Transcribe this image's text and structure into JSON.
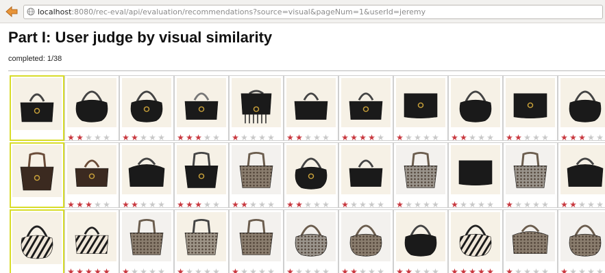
{
  "browser": {
    "url_host": "localhost",
    "url_rest": ":8080/rec-eval/api/evaluation/recommendations?source=visual&pageNum=1&userId=jeremy"
  },
  "page": {
    "title": "Part I: User judge by visual similarity",
    "completed": "completed: 1/38"
  },
  "colors": {
    "query_border": "#d8dc29",
    "star_on": "#c8383f",
    "star_off": "#c9c9c9"
  },
  "rows": [
    {
      "query": {
        "bag": "black-satchel-gold-logo"
      },
      "recommendations": [
        {
          "bag": "black-hobo",
          "rating": 2
        },
        {
          "bag": "black-leather-hobo-ring",
          "rating": 2
        },
        {
          "bag": "black-patent-shoulder-logo",
          "rating": 3
        },
        {
          "bag": "black-fringe-tote",
          "rating": 1
        },
        {
          "bag": "black-top-handle",
          "rating": 2
        },
        {
          "bag": "black-large-satchel-logo",
          "rating": 4
        },
        {
          "bag": "black-clutch-gold-ring",
          "rating": 1
        },
        {
          "bag": "black-small-hobo",
          "rating": 2
        },
        {
          "bag": "black-flap-chain-logo",
          "rating": 2
        },
        {
          "bag": "black-bamboo-hobo",
          "rating": 3
        }
      ]
    },
    {
      "query": {
        "bag": "dark-brown-tote-ring"
      },
      "recommendations": [
        {
          "bag": "brown-satchel-logo",
          "rating": 3
        },
        {
          "bag": "black-doctor-bag",
          "rating": 2
        },
        {
          "bag": "black-tote-ring",
          "rating": 3
        },
        {
          "bag": "monogram-tote-brown",
          "rating": 2
        },
        {
          "bag": "black-hobo-ring",
          "rating": 2
        },
        {
          "bag": "black-beaded-lady-bag",
          "rating": 1
        },
        {
          "bag": "monogram-tote-grey",
          "rating": 1
        },
        {
          "bag": "black-patent-clutch",
          "rating": 1
        },
        {
          "bag": "grey-monogram-tote",
          "rating": 1
        },
        {
          "bag": "black-boston-bag",
          "rating": 2
        }
      ]
    },
    {
      "query": {
        "bag": "zebra-hobo"
      },
      "recommendations": [
        {
          "bag": "zebra-shoulder-bag",
          "rating": 5
        },
        {
          "bag": "monogram-tote-brown-trim",
          "rating": 1
        },
        {
          "bag": "grey-canvas-tote",
          "rating": 1
        },
        {
          "bag": "monogram-shopper",
          "rating": 1
        },
        {
          "bag": "grey-monogram-hobo",
          "rating": 1
        },
        {
          "bag": "monogram-hobo-tassel",
          "rating": 2
        },
        {
          "bag": "black-leather-hobo",
          "rating": 2
        },
        {
          "bag": "zebra-bamboo-hobo",
          "rating": 5
        },
        {
          "bag": "monogram-frame-satchel",
          "rating": 1
        },
        {
          "bag": "monogram-large-hobo",
          "rating": 1
        }
      ]
    }
  ]
}
